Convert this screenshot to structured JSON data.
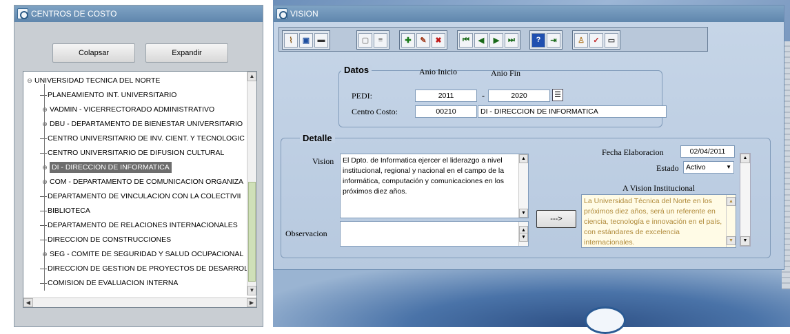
{
  "left_window": {
    "title": "CENTROS DE COSTO",
    "collapse_label": "Colapsar",
    "expand_label": "Expandir",
    "tree": [
      {
        "prefix": "⊖",
        "label": "UNIVERSIDAD TECNICA DEL NORTE",
        "root": true
      },
      {
        "prefix": "",
        "label": "PLANEAMIENTO INT. UNIVERSITARIO"
      },
      {
        "prefix": "⊕",
        "label": "VADMIN - VICERRECTORADO ADMINISTRATIVO"
      },
      {
        "prefix": "⊕",
        "label": "DBU - DEPARTAMENTO DE BIENESTAR UNIVERSITARIO"
      },
      {
        "prefix": "",
        "label": "CENTRO UNIVERSITARIO DE INV. CIENT. Y TECNOLOGIC"
      },
      {
        "prefix": "",
        "label": "CENTRO UNIVERSITARIO DE DIFUSION CULTURAL"
      },
      {
        "prefix": "⊕",
        "label": "DI - DIRECCION DE INFORMATICA",
        "selected": true
      },
      {
        "prefix": "⊕",
        "label": "COM - DEPARTAMENTO DE COMUNICACION ORGANIZA"
      },
      {
        "prefix": "",
        "label": "DEPARTAMENTO DE VINCULACION CON LA COLECTIVII"
      },
      {
        "prefix": "",
        "label": "BIBLIOTECA"
      },
      {
        "prefix": "",
        "label": "DEPARTAMENTO DE RELACIONES INTERNACIONALES"
      },
      {
        "prefix": "",
        "label": "DIRECCION DE CONSTRUCCIONES"
      },
      {
        "prefix": "⊕",
        "label": "SEG - COMITE DE SEGURIDAD Y SALUD OCUPACIONAL"
      },
      {
        "prefix": "",
        "label": "DIRECCION DE GESTION DE PROYECTOS DE DESARROL"
      },
      {
        "prefix": "",
        "label": "COMISION DE EVALUACION INTERNA"
      }
    ]
  },
  "right_window": {
    "title": "VISION",
    "datos": {
      "legend": "Datos",
      "anio_inicio_label": "Anio Inicio",
      "anio_fin_label": "Anio Fin",
      "pedi_label": "PEDI:",
      "anio_inicio": "2011",
      "dash": "-",
      "anio_fin": "2020",
      "centro_costo_label": "Centro Costo:",
      "centro_codigo": "00210",
      "centro_nombre": "DI - DIRECCION DE INFORMATICA"
    },
    "detalle": {
      "legend": "Detalle",
      "vision_label": "Vision",
      "vision_text": "El Dpto. de Informatica ejercer el liderazgo a nivel institucional, regional y nacional en el campo de la informática, computación y comunicaciones en los próximos diez años.",
      "observacion_label": "Observacion",
      "observacion_text": "",
      "transfer_label": "--->",
      "fecha_label": "Fecha Elaboracion",
      "fecha_value": "02/04/2011",
      "estado_label": "Estado",
      "estado_value": "Activo",
      "a_vision_label": "A Vision Institucional",
      "a_vision_text": "La Universidad Técnica del Norte en los próximos diez años, será un referente en ciencia, tecnología e innovación en el país, con estándares de excelencia internacionales."
    }
  },
  "toolbar_icons": [
    "broom-icon",
    "save-icon",
    "print-icon",
    "blank-doc-icon",
    "list-icon",
    "add-record-icon",
    "edit-record-icon",
    "delete-record-icon",
    "first-record-icon",
    "prev-record-icon",
    "next-record-icon",
    "last-record-icon",
    "help-icon",
    "exit-icon",
    "user-icon",
    "check-icon",
    "screen-icon"
  ]
}
